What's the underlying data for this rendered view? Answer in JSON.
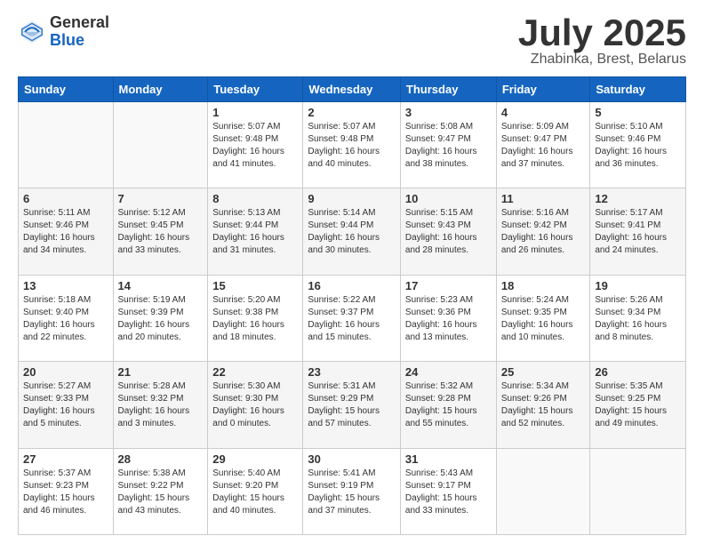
{
  "header": {
    "logo_general": "General",
    "logo_blue": "Blue",
    "month_title": "July 2025",
    "location": "Zhabinka, Brest, Belarus"
  },
  "days_of_week": [
    "Sunday",
    "Monday",
    "Tuesday",
    "Wednesday",
    "Thursday",
    "Friday",
    "Saturday"
  ],
  "weeks": [
    [
      {
        "day": "",
        "info": ""
      },
      {
        "day": "",
        "info": ""
      },
      {
        "day": "1",
        "info": "Sunrise: 5:07 AM\nSunset: 9:48 PM\nDaylight: 16 hours and 41 minutes."
      },
      {
        "day": "2",
        "info": "Sunrise: 5:07 AM\nSunset: 9:48 PM\nDaylight: 16 hours and 40 minutes."
      },
      {
        "day": "3",
        "info": "Sunrise: 5:08 AM\nSunset: 9:47 PM\nDaylight: 16 hours and 38 minutes."
      },
      {
        "day": "4",
        "info": "Sunrise: 5:09 AM\nSunset: 9:47 PM\nDaylight: 16 hours and 37 minutes."
      },
      {
        "day": "5",
        "info": "Sunrise: 5:10 AM\nSunset: 9:46 PM\nDaylight: 16 hours and 36 minutes."
      }
    ],
    [
      {
        "day": "6",
        "info": "Sunrise: 5:11 AM\nSunset: 9:46 PM\nDaylight: 16 hours and 34 minutes."
      },
      {
        "day": "7",
        "info": "Sunrise: 5:12 AM\nSunset: 9:45 PM\nDaylight: 16 hours and 33 minutes."
      },
      {
        "day": "8",
        "info": "Sunrise: 5:13 AM\nSunset: 9:44 PM\nDaylight: 16 hours and 31 minutes."
      },
      {
        "day": "9",
        "info": "Sunrise: 5:14 AM\nSunset: 9:44 PM\nDaylight: 16 hours and 30 minutes."
      },
      {
        "day": "10",
        "info": "Sunrise: 5:15 AM\nSunset: 9:43 PM\nDaylight: 16 hours and 28 minutes."
      },
      {
        "day": "11",
        "info": "Sunrise: 5:16 AM\nSunset: 9:42 PM\nDaylight: 16 hours and 26 minutes."
      },
      {
        "day": "12",
        "info": "Sunrise: 5:17 AM\nSunset: 9:41 PM\nDaylight: 16 hours and 24 minutes."
      }
    ],
    [
      {
        "day": "13",
        "info": "Sunrise: 5:18 AM\nSunset: 9:40 PM\nDaylight: 16 hours and 22 minutes."
      },
      {
        "day": "14",
        "info": "Sunrise: 5:19 AM\nSunset: 9:39 PM\nDaylight: 16 hours and 20 minutes."
      },
      {
        "day": "15",
        "info": "Sunrise: 5:20 AM\nSunset: 9:38 PM\nDaylight: 16 hours and 18 minutes."
      },
      {
        "day": "16",
        "info": "Sunrise: 5:22 AM\nSunset: 9:37 PM\nDaylight: 16 hours and 15 minutes."
      },
      {
        "day": "17",
        "info": "Sunrise: 5:23 AM\nSunset: 9:36 PM\nDaylight: 16 hours and 13 minutes."
      },
      {
        "day": "18",
        "info": "Sunrise: 5:24 AM\nSunset: 9:35 PM\nDaylight: 16 hours and 10 minutes."
      },
      {
        "day": "19",
        "info": "Sunrise: 5:26 AM\nSunset: 9:34 PM\nDaylight: 16 hours and 8 minutes."
      }
    ],
    [
      {
        "day": "20",
        "info": "Sunrise: 5:27 AM\nSunset: 9:33 PM\nDaylight: 16 hours and 5 minutes."
      },
      {
        "day": "21",
        "info": "Sunrise: 5:28 AM\nSunset: 9:32 PM\nDaylight: 16 hours and 3 minutes."
      },
      {
        "day": "22",
        "info": "Sunrise: 5:30 AM\nSunset: 9:30 PM\nDaylight: 16 hours and 0 minutes."
      },
      {
        "day": "23",
        "info": "Sunrise: 5:31 AM\nSunset: 9:29 PM\nDaylight: 15 hours and 57 minutes."
      },
      {
        "day": "24",
        "info": "Sunrise: 5:32 AM\nSunset: 9:28 PM\nDaylight: 15 hours and 55 minutes."
      },
      {
        "day": "25",
        "info": "Sunrise: 5:34 AM\nSunset: 9:26 PM\nDaylight: 15 hours and 52 minutes."
      },
      {
        "day": "26",
        "info": "Sunrise: 5:35 AM\nSunset: 9:25 PM\nDaylight: 15 hours and 49 minutes."
      }
    ],
    [
      {
        "day": "27",
        "info": "Sunrise: 5:37 AM\nSunset: 9:23 PM\nDaylight: 15 hours and 46 minutes."
      },
      {
        "day": "28",
        "info": "Sunrise: 5:38 AM\nSunset: 9:22 PM\nDaylight: 15 hours and 43 minutes."
      },
      {
        "day": "29",
        "info": "Sunrise: 5:40 AM\nSunset: 9:20 PM\nDaylight: 15 hours and 40 minutes."
      },
      {
        "day": "30",
        "info": "Sunrise: 5:41 AM\nSunset: 9:19 PM\nDaylight: 15 hours and 37 minutes."
      },
      {
        "day": "31",
        "info": "Sunrise: 5:43 AM\nSunset: 9:17 PM\nDaylight: 15 hours and 33 minutes."
      },
      {
        "day": "",
        "info": ""
      },
      {
        "day": "",
        "info": ""
      }
    ]
  ]
}
